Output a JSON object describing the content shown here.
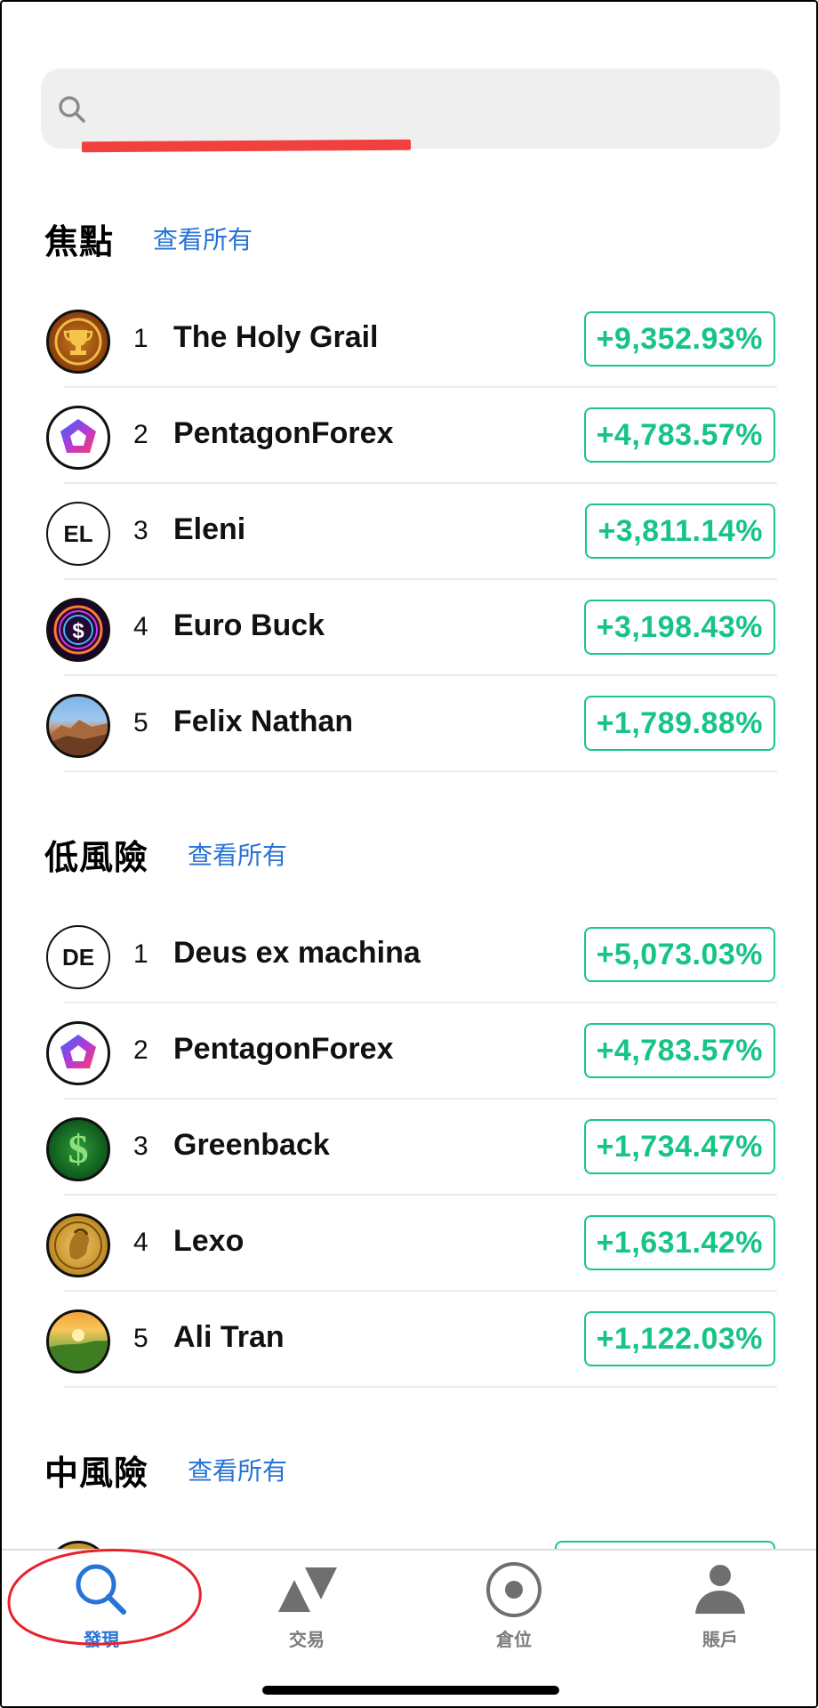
{
  "search": {
    "placeholder": ""
  },
  "sections": [
    {
      "title": "焦點",
      "link": "查看所有",
      "rows": [
        {
          "rank": "1",
          "name": "The Holy Grail",
          "value": "+9,352.93%",
          "avatar": "trophy-avatar"
        },
        {
          "rank": "2",
          "name": "PentagonForex",
          "value": "+4,783.57%",
          "avatar": "pentagon-logo-avatar"
        },
        {
          "rank": "3",
          "name": "Eleni",
          "value": "+3,811.14%",
          "avatar": "initials-avatar",
          "initials": "EL"
        },
        {
          "rank": "4",
          "name": "Euro Buck",
          "value": "+3,198.43%",
          "avatar": "neon-coin-avatar"
        },
        {
          "rank": "5",
          "name": "Felix Nathan",
          "value": "+1,789.88%",
          "avatar": "mountain-photo-avatar"
        }
      ]
    },
    {
      "title": "低風險",
      "link": "查看所有",
      "rows": [
        {
          "rank": "1",
          "name": "Deus ex machina",
          "value": "+5,073.03%",
          "avatar": "initials-avatar",
          "initials": "DE"
        },
        {
          "rank": "2",
          "name": "PentagonForex",
          "value": "+4,783.57%",
          "avatar": "pentagon-logo-avatar"
        },
        {
          "rank": "3",
          "name": "Greenback",
          "value": "+1,734.47%",
          "avatar": "dollar-sign-avatar"
        },
        {
          "rank": "4",
          "name": "Lexo",
          "value": "+1,631.42%",
          "avatar": "gold-coin-avatar"
        },
        {
          "rank": "5",
          "name": "Ali Tran",
          "value": "+1,122.03%",
          "avatar": "sunset-photo-avatar"
        }
      ]
    },
    {
      "title": "中風險",
      "link": "查看所有"
    }
  ],
  "tabs": [
    {
      "label": "發現",
      "icon": "search-icon",
      "active": true
    },
    {
      "label": "交易",
      "icon": "trade-triangles-icon",
      "active": false
    },
    {
      "label": "倉位",
      "icon": "target-circle-icon",
      "active": false
    },
    {
      "label": "賬戶",
      "icon": "person-icon",
      "active": false
    }
  ],
  "colors": {
    "accent": "#2873d6",
    "positive": "#16c485",
    "highlight_red": "#f0413f"
  }
}
